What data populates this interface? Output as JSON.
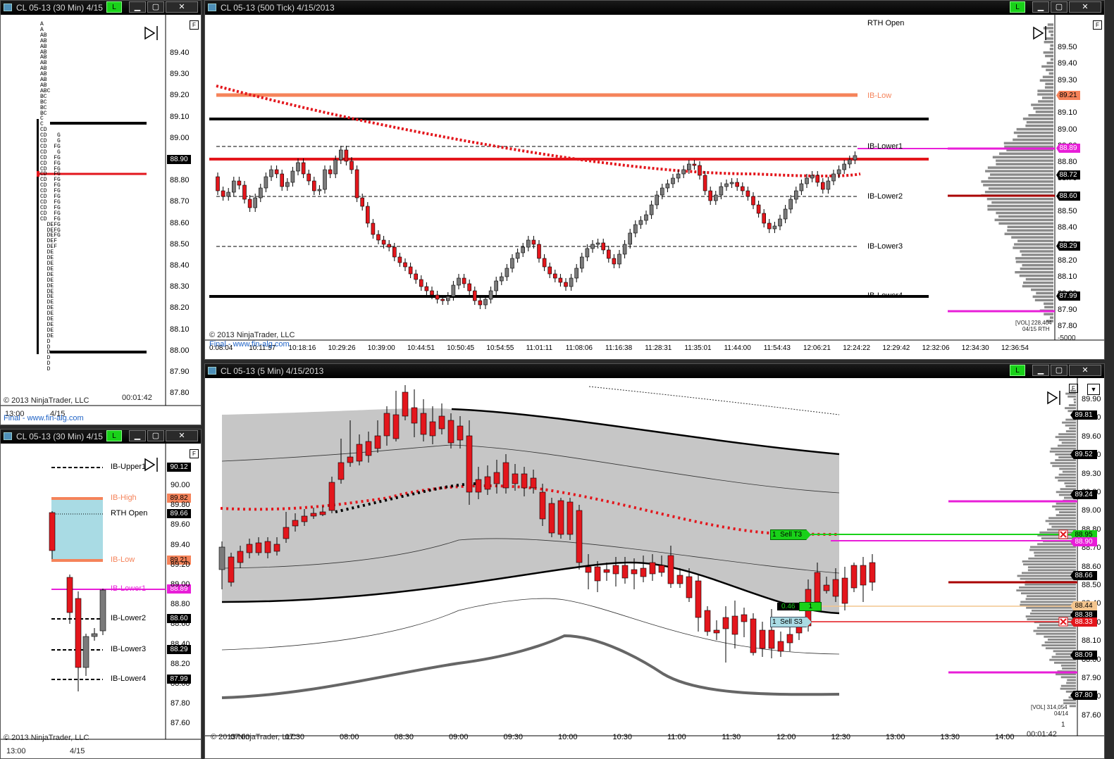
{
  "colors": {
    "up": "#7a7a7a",
    "down": "#e3161c",
    "accent_green": "#19d119",
    "ib_orange": "#f5835a",
    "magenta": "#e81ed8"
  },
  "windows": {
    "w1": {
      "title": "CL 05-13 (30 Min)  4/15",
      "link_label": "L",
      "buttons": [
        "▁",
        "▢",
        "✕"
      ],
      "copyright": "© 2013 NinjaTrader, LLC",
      "timer": "00:01:42",
      "x_labels": [
        "13:00",
        "4/15"
      ],
      "footer": "Final - www.fin-alg.com",
      "f_label": "F",
      "y_labels": [
        "89.40",
        "89.30",
        "89.20",
        "89.10",
        "89.00",
        "88.90",
        "88.80",
        "88.70",
        "88.60",
        "88.50",
        "88.40",
        "88.30",
        "88.20",
        "88.10",
        "88.00",
        "87.90",
        "87.80"
      ],
      "price_marker": "88.90",
      "tpo_rows": [
        "A",
        "A",
        "AB",
        "AB",
        "AB",
        "AB",
        "AB",
        "AB",
        "AB",
        "AB",
        "AB",
        "AB",
        "ABC",
        "BC",
        "BC",
        "BC",
        "BC",
        "C",
        "C",
        "CD",
        "CD   G",
        "CD   G",
        "CD  FG",
        "CD   G",
        "CD  FG",
        "CD  FG",
        "CD  FG",
        "CD  FG",
        "CD  FG",
        "CD  FG",
        "CD  FG",
        "CD  FG",
        "CD  FG",
        "CD  FG",
        "CD  FG",
        "CD  FG",
        "  DEFG",
        "  DEFG",
        "  DEFG",
        "  DEF",
        "  DEF",
        "  DE",
        "  DE",
        "  DE",
        "  DE",
        "  DE",
        "  DE",
        "  DE",
        "  DE",
        "  DE",
        "  DE",
        "  DE",
        "  DE",
        "  DE",
        "  DE",
        "  DE",
        "  DE",
        "  D",
        "  D",
        "  D",
        "  D",
        "  D",
        "  D"
      ]
    },
    "w2": {
      "title": "CL 05-13 (30 Min)  4/15",
      "link_label": "L",
      "buttons": [
        "▁",
        "▢",
        "✕"
      ],
      "copyright": "© 2013 NinjaTrader, LLC",
      "x_labels": [
        "13:00",
        "4/15"
      ],
      "f_label": "F",
      "y_labels": [
        "90.00",
        "89.80",
        "89.60",
        "89.40",
        "89.20",
        "89.00",
        "88.80",
        "88.60",
        "88.40",
        "88.20",
        "88.00",
        "87.80",
        "87.60"
      ],
      "levels": [
        {
          "name": "IB-Upper1",
          "value": "90.12",
          "color": "#000000"
        },
        {
          "name": "IB-High",
          "value": "89.82",
          "color": "#f5835a"
        },
        {
          "name": "RTH Open",
          "value": "89.66",
          "color": "#000000"
        },
        {
          "name": "IB-Low",
          "value": "89.21",
          "color": "#f5835a"
        },
        {
          "name": "IB-Lower1",
          "value": "88.89",
          "color": "#e81ed8"
        },
        {
          "name": "IB-Lower2",
          "value": "88.60",
          "color": "#000000"
        },
        {
          "name": "IB-Lower3",
          "value": "88.29",
          "color": "#000000"
        },
        {
          "name": "IB-Lower4",
          "value": "87.99",
          "color": "#000000"
        }
      ]
    },
    "w3": {
      "title": "CL 05-13 (500 Tick)  4/15/2013",
      "link_label": "L",
      "buttons": [
        "▁",
        "▢",
        "✕"
      ],
      "copyright": "© 2013 NinjaTrader, LLC",
      "footer": "Final - www.fin-alg.com",
      "f_label": "F",
      "x_labels": [
        "0:08:04",
        "10:11:57",
        "10:18:16",
        "10:29:26",
        "10:39:00",
        "10:44:51",
        "10:50:45",
        "10:54:55",
        "11:01:11",
        "11:08:06",
        "11:16:38",
        "11:28:31",
        "11:35:01",
        "11:44:00",
        "11:54:43",
        "12:06:21",
        "12:24:22",
        "12:29:42",
        "12:32:06",
        "12:34:30",
        "12:36:54"
      ],
      "y_labels": [
        "89.50",
        "89.40",
        "89.30",
        "89.20",
        "89.10",
        "89.00",
        "88.90",
        "88.80",
        "88.70",
        "88.60",
        "88.50",
        "88.40",
        "88.30",
        "88.20",
        "88.10",
        "88.00",
        "87.90",
        "87.80"
      ],
      "level_labels": [
        "RTH Open",
        "IB-Low",
        "IB-Lower1",
        "IB-Lower2",
        "IB-Lower3",
        "IB-Lower4"
      ],
      "markers": [
        {
          "v": "89.21",
          "bg": "#f5835a",
          "fg": "#000"
        },
        {
          "v": "88.89",
          "bg": "#e81ed8",
          "fg": "#fff"
        },
        {
          "v": "88.72",
          "bg": "#000",
          "fg": "#fff"
        },
        {
          "v": "88.60",
          "bg": "#000",
          "fg": "#fff"
        },
        {
          "v": "88.29",
          "bg": "#000",
          "fg": "#fff"
        },
        {
          "v": "87.99",
          "bg": "#000",
          "fg": "#fff"
        }
      ],
      "vol_label": "[VOL] 228,404",
      "vol_sub": "04/15 RTH",
      "vol_axis": "-5000"
    },
    "w4": {
      "title": "CL 05-13 (5 Min)  4/15/2013",
      "link_label": "L",
      "buttons": [
        "▁",
        "▢",
        "✕"
      ],
      "copyright": "© 2013 NinjaTrader, LLC",
      "timer": "00:01:42",
      "f_label": "F",
      "x_labels": [
        "07:00",
        "07:30",
        "08:00",
        "08:30",
        "09:00",
        "09:30",
        "10:00",
        "10:30",
        "11:00",
        "11:30",
        "12:00",
        "12:30",
        "13:00",
        "13:30",
        "14:00"
      ],
      "y_labels": [
        "89.90",
        "89.70",
        "89.60",
        "89.50",
        "89.30",
        "89.20",
        "89.00",
        "88.80",
        "88.70",
        "88.60",
        "88.50",
        "88.40",
        "88.20",
        "88.10",
        "88.00",
        "87.90",
        "87.70",
        "87.60"
      ],
      "markers": [
        {
          "v": "89.81",
          "bg": "#000",
          "fg": "#fff"
        },
        {
          "v": "89.52",
          "bg": "#000",
          "fg": "#fff"
        },
        {
          "v": "89.24",
          "bg": "#000",
          "fg": "#fff"
        },
        {
          "v": "88.95",
          "bg": "#19d119",
          "fg": "#000"
        },
        {
          "v": "88.90",
          "bg": "#e81ed8",
          "fg": "#fff"
        },
        {
          "v": "88.66",
          "bg": "#000",
          "fg": "#fff"
        },
        {
          "v": "88.44",
          "bg": "#f3c58e",
          "fg": "#000"
        },
        {
          "v": "88.38",
          "bg": "#000",
          "fg": "#fff"
        },
        {
          "v": "88.33",
          "bg": "#e3161c",
          "fg": "#fff"
        },
        {
          "v": "88.09",
          "bg": "#000",
          "fg": "#fff"
        },
        {
          "v": "87.80",
          "bg": "#000",
          "fg": "#fff"
        }
      ],
      "orders": {
        "sell_t3": "Sell T3",
        "sell_t3_qty": "1",
        "sell_s3": "Sell S3",
        "sell_s3_qty": "1",
        "pnl": "0.46",
        "pos_qty": "1"
      },
      "vol_label": "[VOL] 314,054",
      "vol_sub": "04/14",
      "vol_axis": "1"
    }
  }
}
